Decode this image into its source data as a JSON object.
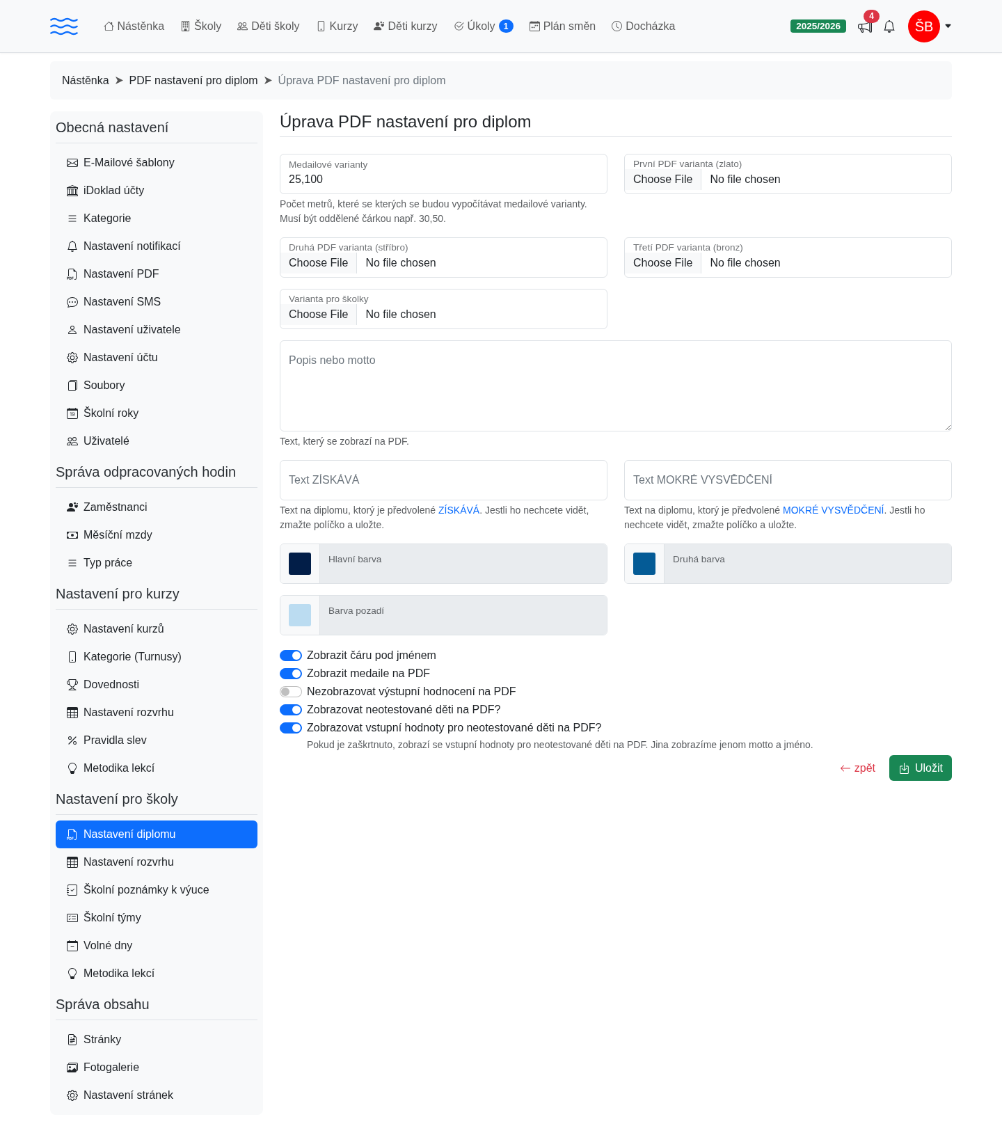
{
  "navbar": {
    "items": [
      {
        "label": "Nástěnka"
      },
      {
        "label": "Školy"
      },
      {
        "label": "Děti školy"
      },
      {
        "label": "Kurzy"
      },
      {
        "label": "Děti kurzy"
      },
      {
        "label": "Úkoly",
        "badge": "1"
      },
      {
        "label": "Plán směn"
      },
      {
        "label": "Docházka"
      }
    ],
    "school_year": "2025/2026",
    "announcements_count": "4",
    "avatar_initials": "ŠB"
  },
  "breadcrumb": [
    {
      "label": "Nástěnka",
      "current": false
    },
    {
      "label": "PDF nastavení pro diplom",
      "current": false
    },
    {
      "label": "Úprava PDF nastavení pro diplom",
      "current": true
    }
  ],
  "sidebar": {
    "sections": [
      {
        "title": "Obecná nastavení",
        "items": [
          {
            "label": "E-Mailové šablony",
            "selected": false
          },
          {
            "label": "iDoklad účty",
            "selected": false
          },
          {
            "label": "Kategorie",
            "selected": false
          },
          {
            "label": "Nastavení notifikací",
            "selected": false
          },
          {
            "label": "Nastavení PDF",
            "selected": false
          },
          {
            "label": "Nastavení SMS",
            "selected": false
          },
          {
            "label": "Nastavení uživatele",
            "selected": false
          },
          {
            "label": "Nastavení účtu",
            "selected": false
          },
          {
            "label": "Soubory",
            "selected": false
          },
          {
            "label": "Školní roky",
            "selected": false
          },
          {
            "label": "Uživatelé",
            "selected": false
          }
        ]
      },
      {
        "title": "Správa odpracovaných hodin",
        "items": [
          {
            "label": "Zaměstnanci",
            "selected": false
          },
          {
            "label": "Měsíční mzdy",
            "selected": false
          },
          {
            "label": "Typ práce",
            "selected": false
          }
        ]
      },
      {
        "title": "Nastavení pro kurzy",
        "items": [
          {
            "label": "Nastavení kurzů",
            "selected": false
          },
          {
            "label": "Kategorie (Turnusy)",
            "selected": false
          },
          {
            "label": "Dovednosti",
            "selected": false
          },
          {
            "label": "Nastavení rozvrhu",
            "selected": false
          },
          {
            "label": "Pravidla slev",
            "selected": false
          },
          {
            "label": "Metodika lekcí",
            "selected": false
          }
        ]
      },
      {
        "title": "Nastavení pro školy",
        "items": [
          {
            "label": "Nastavení diplomu",
            "selected": true
          },
          {
            "label": "Nastavení rozvrhu",
            "selected": false
          },
          {
            "label": "Školní poznámky k výuce",
            "selected": false
          },
          {
            "label": "Školní týmy",
            "selected": false
          },
          {
            "label": "Volné dny",
            "selected": false
          },
          {
            "label": "Metodika lekcí",
            "selected": false
          }
        ]
      },
      {
        "title": "Správa obsahu",
        "items": [
          {
            "label": "Stránky",
            "selected": false
          },
          {
            "label": "Fotogalerie",
            "selected": false
          },
          {
            "label": "Nastavení stránek",
            "selected": false
          }
        ]
      }
    ]
  },
  "form": {
    "title": "Úprava PDF nastavení pro diplom",
    "fields": [
      {
        "kind": "text",
        "label": "Medailové varianty",
        "value": "25,100",
        "help": "Počet metrů, které se kterých se budou vypočítávat medailové varianty. Musí být oddělené čárkou např. 30,50."
      },
      {
        "kind": "file",
        "label": "První PDF varianta (zlato)",
        "button": "Choose File",
        "status": "No file chosen"
      },
      {
        "kind": "file",
        "label": "Druhá PDF varianta (stříbro)",
        "button": "Choose File",
        "status": "No file chosen"
      },
      {
        "kind": "file",
        "label": "Třetí PDF varianta (bronz)",
        "button": "Choose File",
        "status": "No file chosen"
      },
      {
        "kind": "file",
        "label": "Varianta pro školky",
        "button": "Choose File",
        "status": "No file chosen"
      },
      {
        "kind": "textarea",
        "placeholder": "Popis nebo motto",
        "help": "Text, který se zobrazí na PDF."
      },
      {
        "kind": "text",
        "placeholder": "Text ZÍSKÁVÁ",
        "help": "Text na diplomu, ktorý je předvolené ",
        "help_link": "ZÍSKÁVÁ",
        "help_after": ". Jestli ho nechcete vidět, zmažte políčko a uložte."
      },
      {
        "kind": "text",
        "placeholder": "Text MOKRÉ VYSVĚDČENÍ",
        "help": "Text na diplomu, ktorý je předvolené ",
        "help_link": "MOKRÉ VYSVĚDČENÍ",
        "help_after": ". Jestli ho nechcete vidět, zmažte políčko a uložte."
      },
      {
        "kind": "color",
        "label": "Hlavní barva",
        "color": "#021e48"
      },
      {
        "kind": "color",
        "label": "Druhá barva",
        "color": "#045b96"
      },
      {
        "kind": "color",
        "label": "Barva pozadí",
        "color": "#bbdcf1"
      }
    ],
    "switches": [
      {
        "label": "Zobrazit čáru pod jménem",
        "on": true
      },
      {
        "label": "Zobrazit medaile na PDF",
        "on": true
      },
      {
        "label": "Nezobrazovat výstupní hodnocení na PDF",
        "on": false
      },
      {
        "label": "Zobrazovat neotestované děti na PDF?",
        "on": true
      },
      {
        "label": "Zobrazovat vstupní hodnoty pro neotestované děti na PDF?",
        "on": true,
        "help": "Pokud je zaškrtnuto, zobrazí se vstupní hodnoty pro neotestované děti na PDF. Jina zobrazíme jenom motto a jméno."
      }
    ],
    "back_link": "zpět",
    "save_button": "Uložit"
  }
}
